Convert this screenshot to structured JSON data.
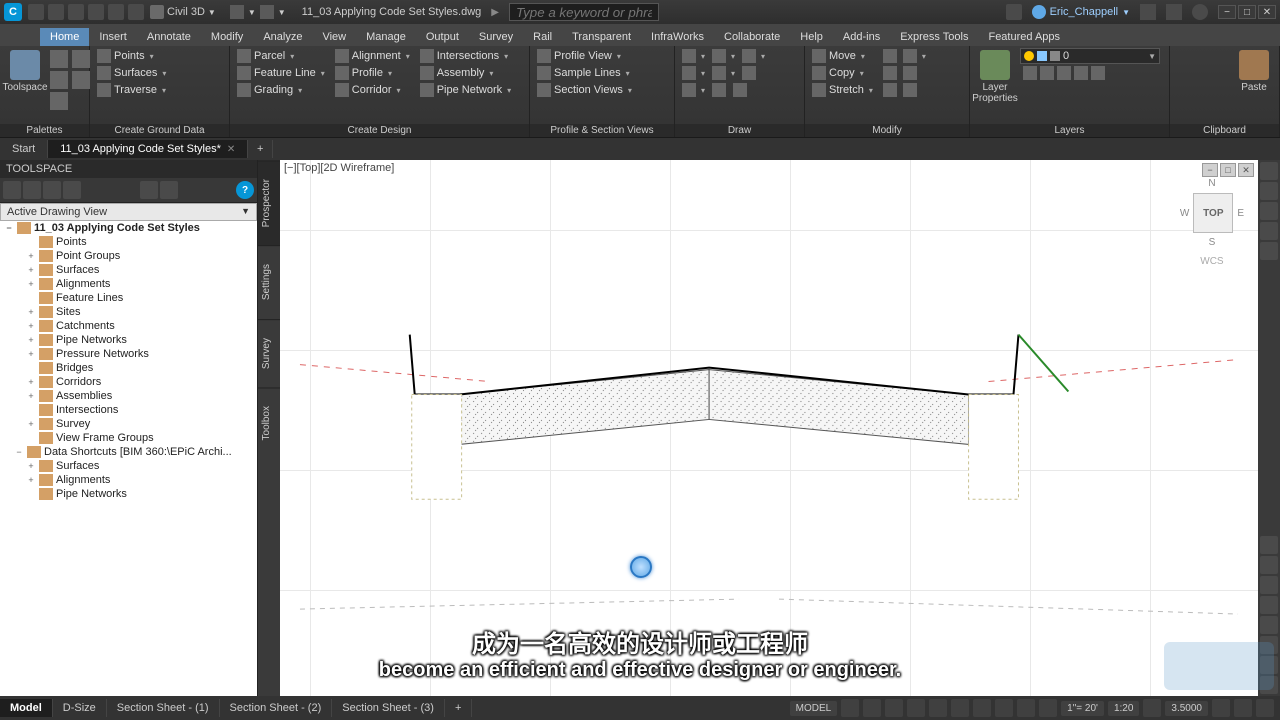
{
  "title": {
    "app_abbr": "C",
    "workspace": "Civil 3D",
    "filename": "11_03 Applying Code Set Styles.dwg",
    "search_placeholder": "Type a keyword or phrase",
    "user": "Eric_Chappell"
  },
  "ribbon_tabs": [
    "Home",
    "Insert",
    "Annotate",
    "Modify",
    "Analyze",
    "View",
    "Manage",
    "Output",
    "Survey",
    "Rail",
    "Transparent",
    "InfraWorks",
    "Collaborate",
    "Help",
    "Add-ins",
    "Express Tools",
    "Featured Apps"
  ],
  "ribbon_active": "Home",
  "panels": {
    "palettes": {
      "label": "Palettes",
      "toolspace": "Toolspace"
    },
    "ground": {
      "label": "Create Ground Data",
      "items": [
        "Points",
        "Surfaces",
        "Traverse"
      ]
    },
    "design": {
      "label": "Create Design",
      "col1": [
        "Parcel",
        "Feature Line",
        "Grading"
      ],
      "col2": [
        "Alignment",
        "Profile",
        "Corridor"
      ],
      "col3": [
        "Intersections",
        "Assembly",
        "Pipe Network"
      ]
    },
    "profile": {
      "label": "Profile & Section Views",
      "items": [
        "Profile View",
        "Sample Lines",
        "Section Views"
      ]
    },
    "draw": {
      "label": "Draw"
    },
    "modify": {
      "label": "Modify",
      "items": [
        "Move",
        "Copy",
        "Stretch"
      ]
    },
    "layers": {
      "label": "Layers",
      "big": "Layer Properties",
      "dropdown": "0"
    },
    "clipboard": {
      "label": "Clipboard",
      "big": "Paste"
    }
  },
  "doc_tabs": [
    {
      "label": "Start",
      "active": false,
      "closable": false
    },
    {
      "label": "11_03 Applying Code Set Styles*",
      "active": true,
      "closable": true
    }
  ],
  "toolspace": {
    "title": "TOOLSPACE",
    "filter": "Active Drawing View",
    "tabs": [
      "Prospector",
      "Settings",
      "Survey",
      "Toolbox"
    ],
    "tree": [
      {
        "label": "11_03 Applying Code Set Styles",
        "root": true,
        "exp": "−",
        "ind": "0"
      },
      {
        "label": "Points",
        "ind": "1",
        "exp": ""
      },
      {
        "label": "Point Groups",
        "ind": "1",
        "exp": "+"
      },
      {
        "label": "Surfaces",
        "ind": "1",
        "exp": "+"
      },
      {
        "label": "Alignments",
        "ind": "1",
        "exp": "+"
      },
      {
        "label": "Feature Lines",
        "ind": "1",
        "exp": ""
      },
      {
        "label": "Sites",
        "ind": "1",
        "exp": "+"
      },
      {
        "label": "Catchments",
        "ind": "1",
        "exp": "+"
      },
      {
        "label": "Pipe Networks",
        "ind": "1",
        "exp": "+"
      },
      {
        "label": "Pressure Networks",
        "ind": "1",
        "exp": "+"
      },
      {
        "label": "Bridges",
        "ind": "1",
        "exp": ""
      },
      {
        "label": "Corridors",
        "ind": "1",
        "exp": "+"
      },
      {
        "label": "Assemblies",
        "ind": "1",
        "exp": "+"
      },
      {
        "label": "Intersections",
        "ind": "1",
        "exp": ""
      },
      {
        "label": "Survey",
        "ind": "1",
        "exp": "+"
      },
      {
        "label": "View Frame Groups",
        "ind": "1",
        "exp": ""
      },
      {
        "label": "Data Shortcuts [BIM 360:\\EPiC Archi...",
        "root": false,
        "exp": "−",
        "ind": "0b"
      },
      {
        "label": "Surfaces",
        "ind": "1",
        "exp": "+"
      },
      {
        "label": "Alignments",
        "ind": "1",
        "exp": "+"
      },
      {
        "label": "Pipe Networks",
        "ind": "1",
        "exp": ""
      }
    ]
  },
  "viewport": {
    "label": "[−][Top][2D Wireframe]",
    "cube_top": "TOP",
    "cube_n": "N",
    "cube_e": "E",
    "cube_s": "S",
    "cube_w": "W",
    "wcs": "WCS"
  },
  "layout_tabs": [
    "Model",
    "D-Size",
    "Section Sheet - (1)",
    "Section Sheet - (2)",
    "Section Sheet - (3)"
  ],
  "layout_active": "Model",
  "status": {
    "mode": "MODEL",
    "scale_combo": "1\"= 20'",
    "ratio": "1:20",
    "pct": "3.5000"
  },
  "subtitle": {
    "cn": "成为一名高效的设计师或工程师",
    "en": "become an efficient and effective designer or engineer."
  }
}
